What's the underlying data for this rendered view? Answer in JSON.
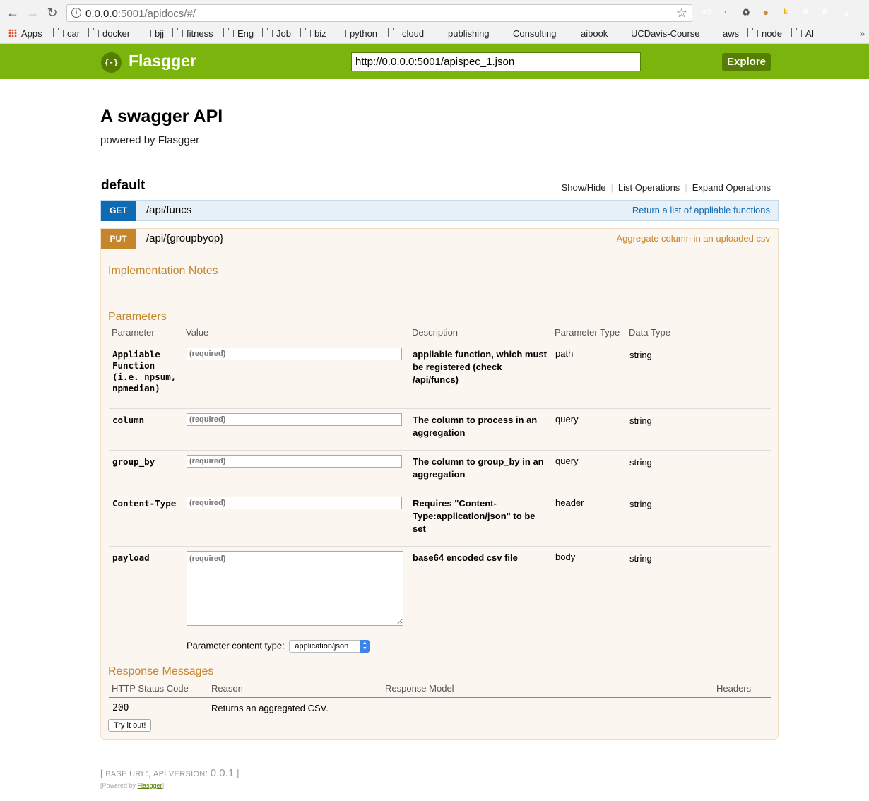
{
  "browser": {
    "url_host": "0.0.0.0",
    "url_rest": ":5001/apidocs/#/",
    "back": "←",
    "forward": "→",
    "reload": "↻",
    "info": "i",
    "star": "☆",
    "bookmarks": [
      "Apps",
      "car",
      "docker",
      "bjj",
      "fitness",
      "Eng",
      "Job",
      "biz",
      "python",
      "cloud",
      "publishing",
      "Consulting",
      "aibook",
      "UCDavis-Course",
      "aws",
      "node",
      "AI"
    ],
    "more": "»",
    "extensions": [
      {
        "label": "uO",
        "color": "#800000"
      },
      {
        "label": "◐",
        "color": "#e6e6e6"
      },
      {
        "label": "♻",
        "color": "#f2f2f2"
      },
      {
        "label": "●",
        "color": "#f2f2f2"
      },
      {
        "label": "k",
        "color": "#222222"
      },
      {
        "label": "G",
        "color": "#c8c8c8"
      },
      {
        "label": "B",
        "color": "#dcdcdc"
      },
      {
        "label": "0",
        "color": "#22aa22"
      }
    ]
  },
  "header": {
    "logo": "{-}",
    "title": "Flasgger",
    "spec_url": "http://0.0.0.0:5001/apispec_1.json",
    "explore_label": "Explore",
    "brand_color": "#7cb40e"
  },
  "info": {
    "title": "A swagger API",
    "description": "powered by Flasgger"
  },
  "resource": {
    "name": "default",
    "links": [
      "Show/Hide",
      "List Operations",
      "Expand Operations"
    ],
    "separator": "|"
  },
  "operations": [
    {
      "method": "GET",
      "path": "/api/funcs",
      "summary": "Return a list of appliable functions",
      "color": "#0f6ab4"
    },
    {
      "method": "PUT",
      "path": "/api/{groupbyop}",
      "summary": "Aggregate column in an uploaded csv",
      "color": "#c5862b"
    }
  ],
  "put_detail": {
    "impl_notes_heading": "Implementation Notes",
    "params_heading": "Parameters",
    "param_headers": [
      "Parameter",
      "Value",
      "Description",
      "Parameter Type",
      "Data Type"
    ],
    "params": [
      {
        "name": "Appliable Function (i.e. npsum, npmedian)",
        "placeholder": "(required)",
        "description": "appliable function, which must be registered (check /api/funcs)",
        "param_type": "path",
        "data_type": "string"
      },
      {
        "name": "column",
        "placeholder": "(required)",
        "description": "The column to process in an aggregation",
        "param_type": "query",
        "data_type": "string"
      },
      {
        "name": "group_by",
        "placeholder": "(required)",
        "description": "The column to group_by in an aggregation",
        "param_type": "query",
        "data_type": "string"
      },
      {
        "name": "Content-Type",
        "placeholder": "(required)",
        "description": "Requires \"Content-Type:application/json\" to be set",
        "param_type": "header",
        "data_type": "string"
      },
      {
        "name": "payload",
        "placeholder": "(required)",
        "description": "base64 encoded csv file",
        "param_type": "body",
        "data_type": "string"
      }
    ],
    "content_type_label": "Parameter content type:",
    "content_type_value": "application/json",
    "responses_heading": "Response Messages",
    "response_headers": [
      "HTTP Status Code",
      "Reason",
      "Response Model",
      "Headers"
    ],
    "responses": [
      {
        "code": "200",
        "reason": "Returns an aggregated CSV."
      }
    ],
    "try_label": "Try it out!"
  },
  "footer": {
    "open_bracket": "[",
    "base_url_label": "BASE URL",
    "colon": ":",
    "comma": ",",
    "api_version_label": "API VERSION",
    "api_version": "0.0.1",
    "close_bracket": "]",
    "powered_prefix": "[Powered by",
    "powered_link": "Flasgger",
    "powered_suffix": "]"
  }
}
